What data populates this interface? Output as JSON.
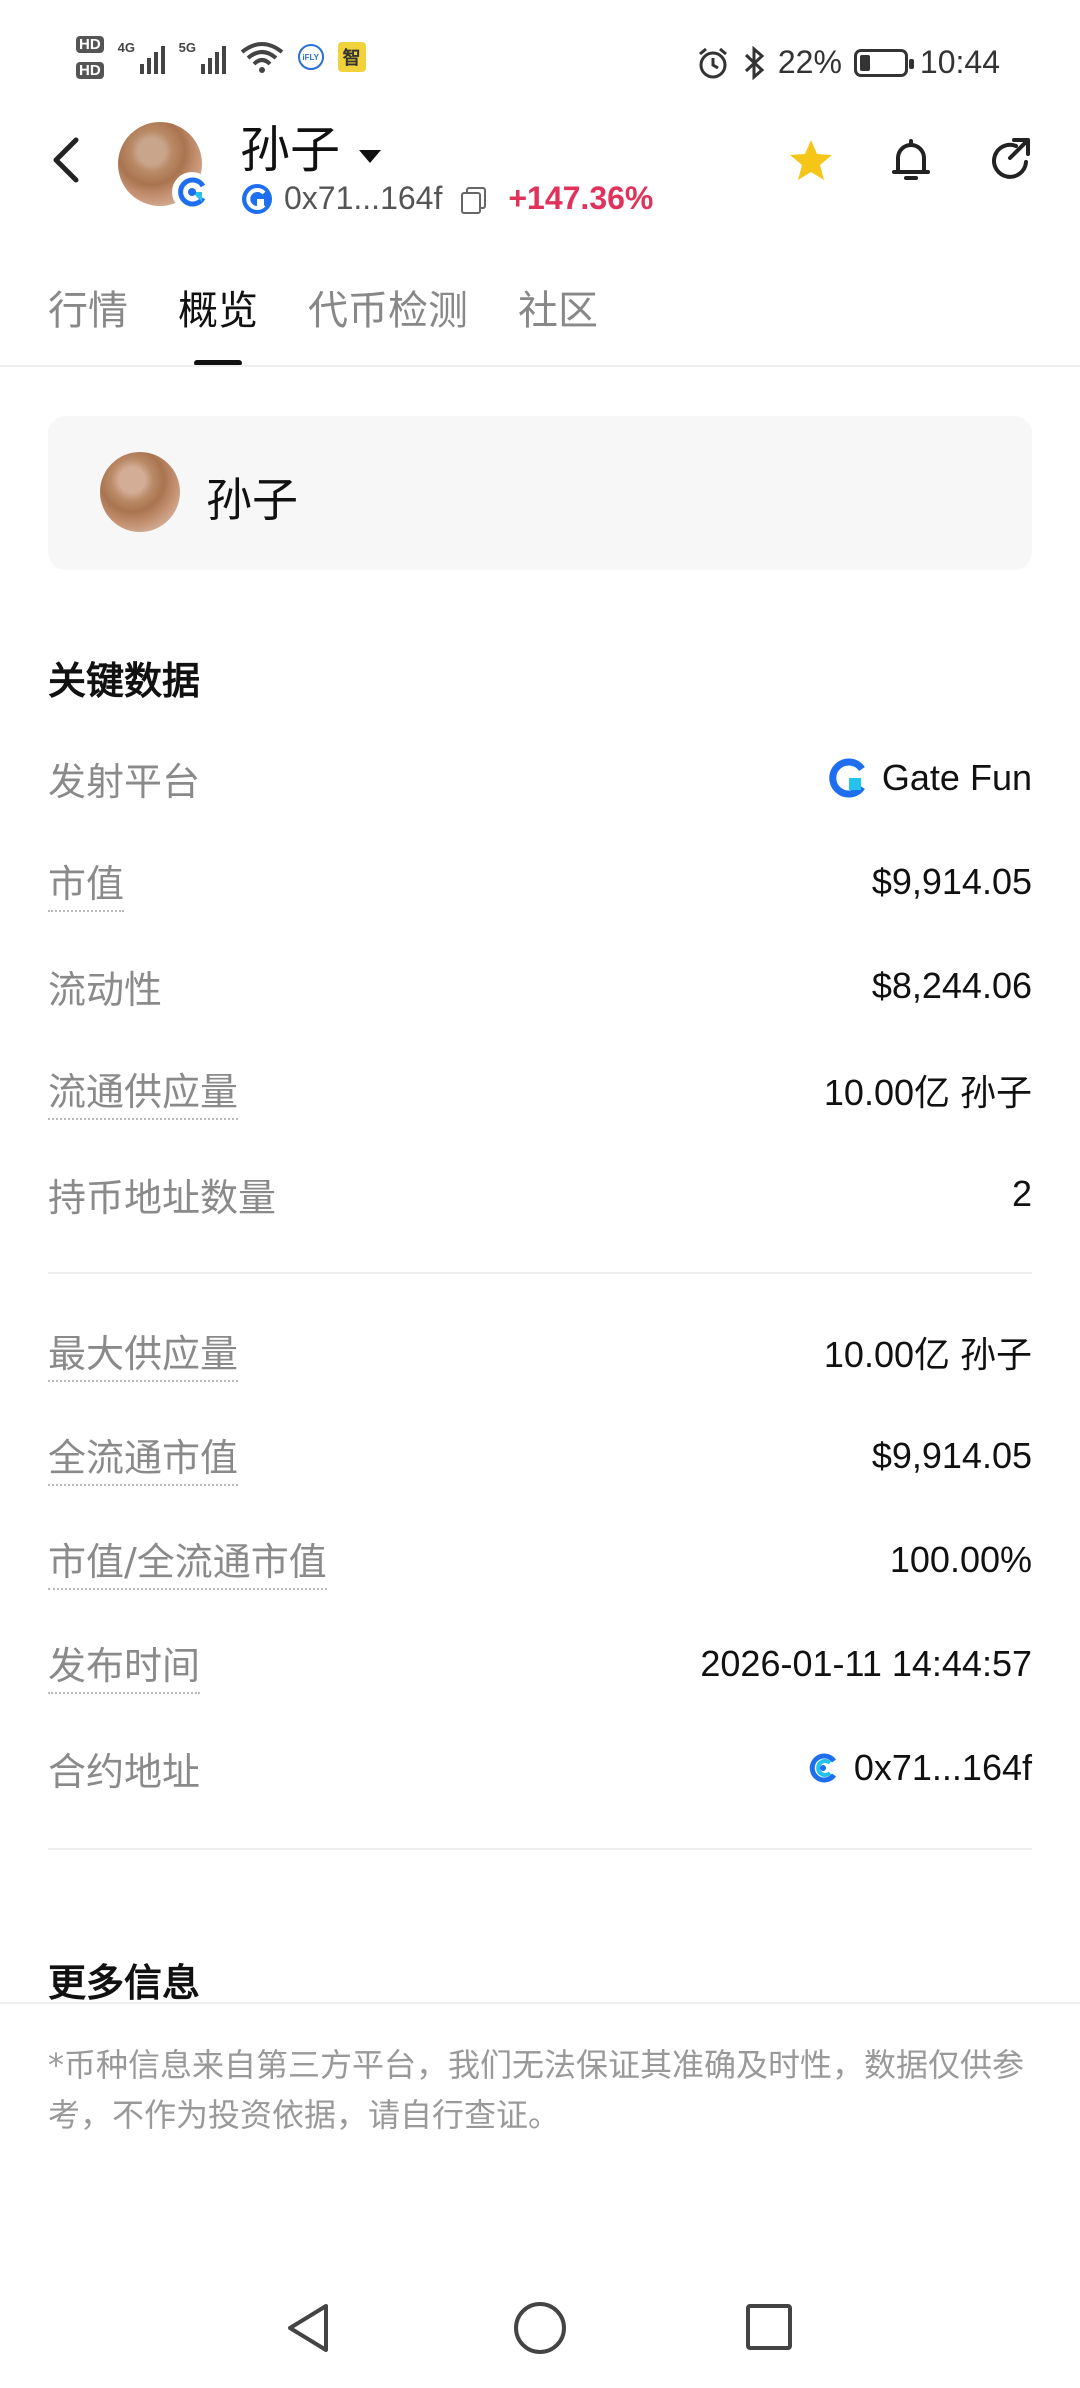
{
  "status_bar": {
    "hd1": "HD",
    "hd2": "HD",
    "net1": "4G",
    "net2": "5G",
    "app1_label": "iFLY",
    "app2_label": "智",
    "battery_percent": 22,
    "battery_text": "22%",
    "time": "10:44"
  },
  "header": {
    "token_name": "孙子",
    "address": "0x71...164f",
    "change": "+147.36%",
    "change_color": "#e0325a"
  },
  "tabs": [
    {
      "label": "行情",
      "active": false
    },
    {
      "label": "概览",
      "active": true
    },
    {
      "label": "代币检测",
      "active": false
    },
    {
      "label": "社区",
      "active": false
    }
  ],
  "token_card": {
    "name": "孙子"
  },
  "key_data": {
    "title": "关键数据",
    "platform_label": "发射平台",
    "platform_value": "Gate Fun",
    "market_cap_label": "市值",
    "market_cap_value": "$9,914.05",
    "liquidity_label": "流动性",
    "liquidity_value": "$8,244.06",
    "circ_supply_label": "流通供应量",
    "circ_supply_value": "10.00亿 孙子",
    "holders_label": "持币地址数量",
    "holders_value": "2",
    "max_supply_label": "最大供应量",
    "max_supply_value": "10.00亿 孙子",
    "fdv_label": "全流通市值",
    "fdv_value": "$9,914.05",
    "mc_fdv_label": "市值/全流通市值",
    "mc_fdv_value": "100.00%",
    "launch_time_label": "发布时间",
    "launch_time_value": "2026-01-11 14:44:57",
    "contract_label": "合约地址",
    "contract_value": "0x71...164f"
  },
  "more_info": {
    "title": "更多信息"
  },
  "disclaimer": "*币种信息来自第三方平台，我们无法保证其准确及时性，数据仅供参考，不作为投资依据，请自行查证。",
  "colors": {
    "brand_blue": "#1e6ff0",
    "star": "#f5c518",
    "accent_red": "#e0325a"
  }
}
